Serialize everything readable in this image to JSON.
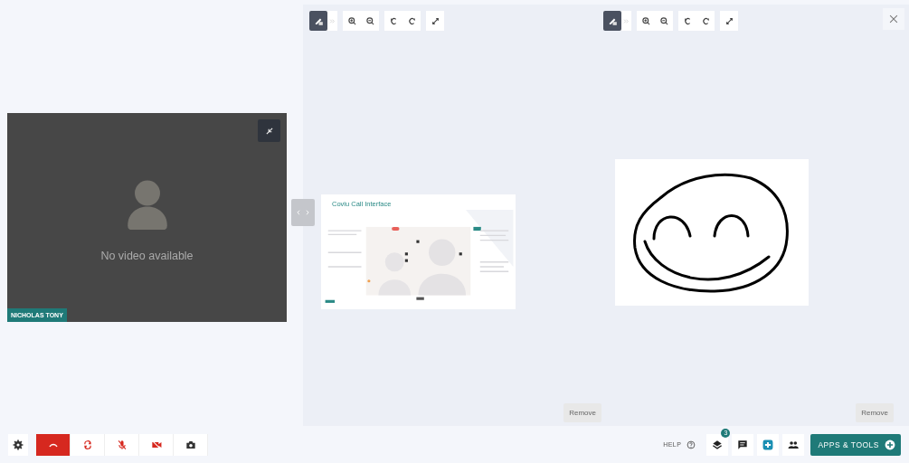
{
  "video_tile": {
    "message": "No video available",
    "participant": "NICHOLAS TONY"
  },
  "boards": [
    {
      "kind": "slide",
      "title": "Coviu Call Interface",
      "remove": "Remove",
      "tools": [
        {
          "kind": "pen",
          "selected": true
        },
        {
          "kind": "more",
          "selected": false
        },
        {
          "kind": "zoom-in",
          "selected": false
        },
        {
          "kind": "zoom-out",
          "selected": false
        },
        {
          "kind": "undo",
          "selected": false
        },
        {
          "kind": "redo",
          "selected": false
        },
        {
          "kind": "expand",
          "selected": false
        }
      ]
    },
    {
      "kind": "whiteboard",
      "remove": "Remove",
      "tools": [
        {
          "kind": "pen",
          "selected": true
        },
        {
          "kind": "more",
          "selected": false
        },
        {
          "kind": "zoom-in",
          "selected": false
        },
        {
          "kind": "zoom-out",
          "selected": false
        },
        {
          "kind": "undo",
          "selected": false
        },
        {
          "kind": "redo",
          "selected": false
        },
        {
          "kind": "expand",
          "selected": false
        }
      ]
    }
  ],
  "call_controls": [
    {
      "kind": "settings"
    },
    {
      "kind": "hangup"
    },
    {
      "kind": "switch"
    },
    {
      "kind": "mic-off"
    },
    {
      "kind": "camera-off"
    },
    {
      "kind": "snapshot"
    }
  ],
  "help": "HELP",
  "side_controls": [
    {
      "kind": "layers",
      "badge": "3"
    },
    {
      "kind": "chat"
    },
    {
      "kind": "add"
    },
    {
      "kind": "people"
    }
  ],
  "apps_button": "APPS & TOOLS"
}
